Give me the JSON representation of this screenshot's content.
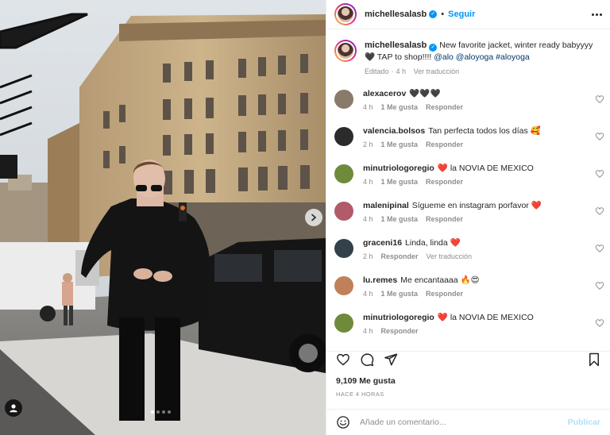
{
  "header": {
    "username": "michellesalasb",
    "separator": "•",
    "follow_label": "Seguir"
  },
  "caption": {
    "username": "michellesalasb",
    "text": "New favorite jacket, winter ready babyyyy 🖤 TAP to shop!!!! ",
    "mentions": "@alo @aloyoga #aloyoga",
    "edited_label": "Editado",
    "separator": "·",
    "time": "4 h",
    "translate_label": "Ver traducción"
  },
  "comments": [
    {
      "username": "alexacerov",
      "text": "🖤🖤🖤",
      "time": "4 h",
      "likes": "1 Me gusta",
      "reply": "Responder",
      "translate": "",
      "avatar_color": "#8a7a6a"
    },
    {
      "username": "valencia.bolsos",
      "text": "Tan perfecta todos los días 🥰",
      "time": "2 h",
      "likes": "1 Me gusta",
      "reply": "Responder",
      "translate": "",
      "avatar_color": "#2b2b2b"
    },
    {
      "username": "minutriologoregio",
      "text": "❤️ la NOVIA DE MEXICO",
      "time": "4 h",
      "likes": "1 Me gusta",
      "reply": "Responder",
      "translate": "",
      "avatar_color": "#6f8a3a"
    },
    {
      "username": "malenipinal",
      "text": "Sígueme en instagram porfavor ❤️",
      "time": "4 h",
      "likes": "1 Me gusta",
      "reply": "Responder",
      "translate": "",
      "avatar_color": "#b05a6a"
    },
    {
      "username": "graceni16",
      "text": "Linda, linda ❤️",
      "time": "2 h",
      "likes": "",
      "reply": "Responder",
      "translate": "Ver traducción",
      "avatar_color": "#34404a"
    },
    {
      "username": "lu.remes",
      "text": "Me encantaaaa 🔥😍",
      "time": "4 h",
      "likes": "1 Me gusta",
      "reply": "Responder",
      "translate": "",
      "avatar_color": "#c0805a"
    },
    {
      "username": "minutriologoregio",
      "text": "❤️ la NOVIA DE MEXICO",
      "time": "4 h",
      "likes": "",
      "reply": "Responder",
      "translate": "",
      "avatar_color": "#6f8a3a"
    }
  ],
  "footer": {
    "likes_count": "9,109 Me gusta",
    "posted": "HACE 4 HORAS",
    "comment_placeholder": "Añade un comentario...",
    "publish_label": "Publicar"
  },
  "media": {
    "carousel_total": 4,
    "carousel_active": 1
  },
  "colors": {
    "accent": "#0095f6",
    "link": "#00376b",
    "muted": "#8e8e8e",
    "heart": "#ed4956"
  }
}
